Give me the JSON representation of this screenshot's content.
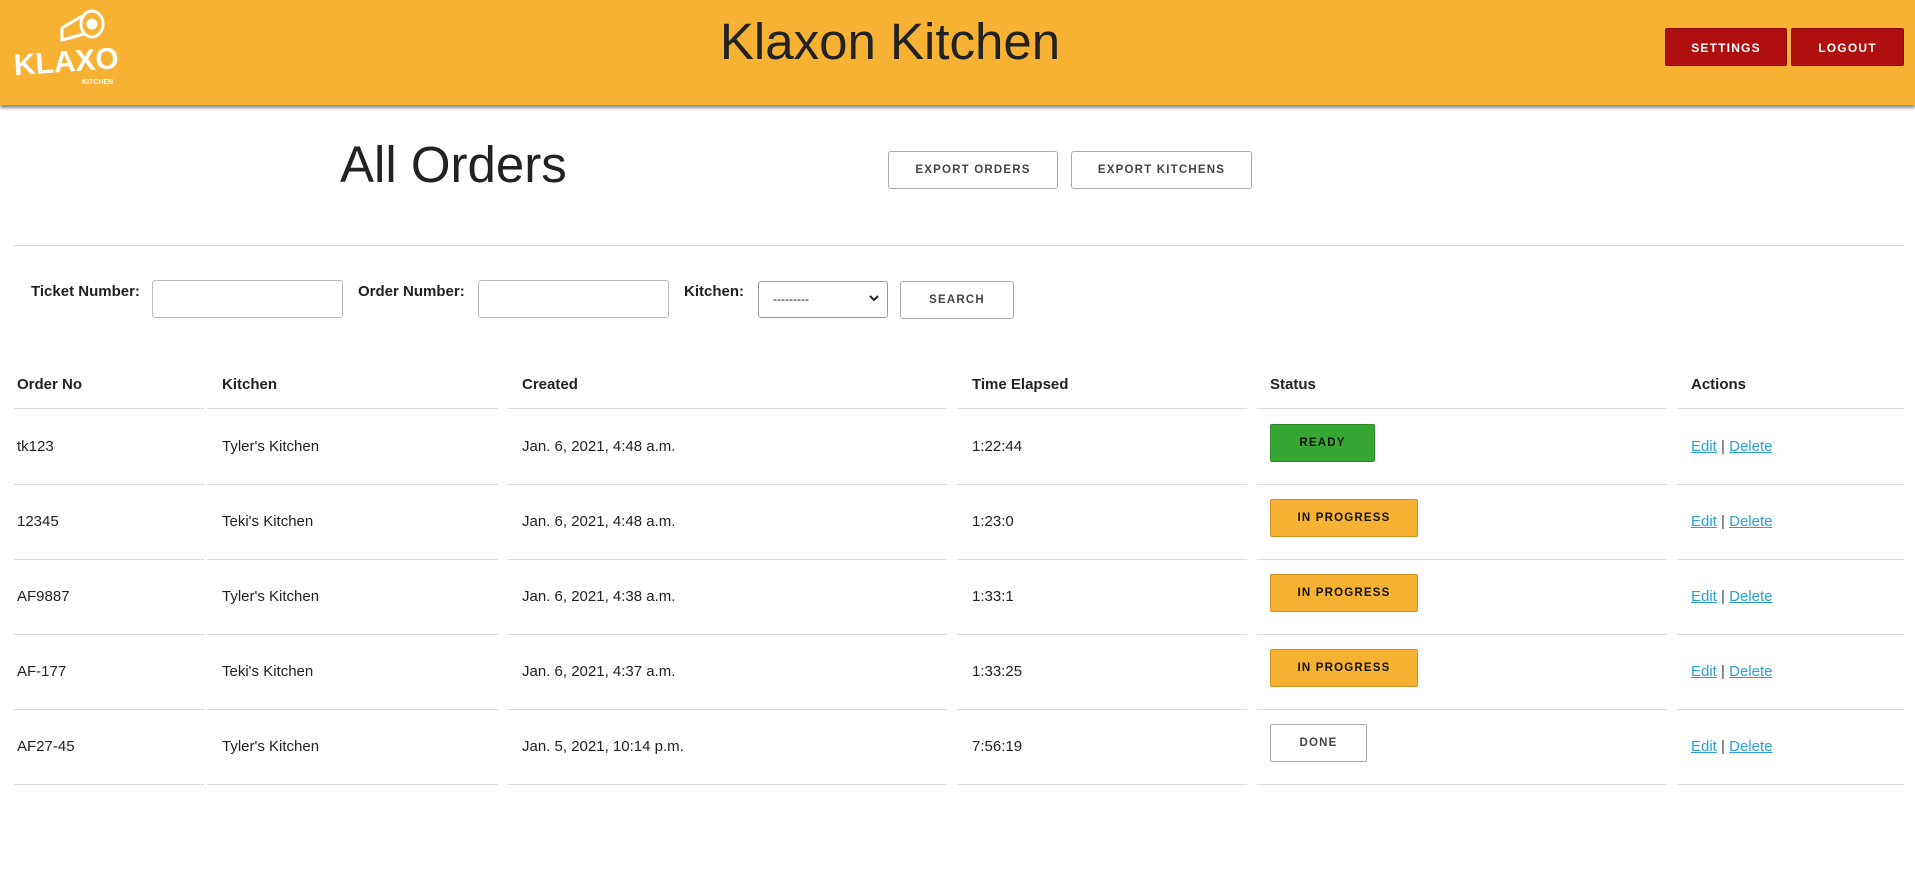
{
  "header": {
    "logo_text": "KLAXON",
    "logo_subtext": "KITCHEN",
    "title": "Klaxon Kitchen",
    "settings_label": "SETTINGS",
    "logout_label": "LOGOUT",
    "bg_color": "#f7b233",
    "button_color": "#b00f10"
  },
  "page": {
    "title": "All Orders",
    "export_orders_label": "EXPORT ORDERS",
    "export_kitchens_label": "EXPORT KITCHENS"
  },
  "search": {
    "ticket_label": "Ticket Number:",
    "ticket_value": "",
    "order_label": "Order Number:",
    "order_value": "",
    "kitchen_label": "Kitchen:",
    "kitchen_selected": "---------",
    "search_label": "SEARCH"
  },
  "table": {
    "columns": [
      "Order No",
      "Kitchen",
      "Created",
      "Time Elapsed",
      "Status",
      "Actions"
    ],
    "rows": [
      {
        "order_no": "tk123",
        "kitchen": "Tyler's Kitchen",
        "created": "Jan. 6, 2021, 4:48 a.m.",
        "elapsed": "1:22:44",
        "status": "READY",
        "edit": "Edit",
        "sep": "|",
        "delete": "Delete"
      },
      {
        "order_no": "12345",
        "kitchen": "Teki's Kitchen",
        "created": "Jan. 6, 2021, 4:48 a.m.",
        "elapsed": "1:23:0",
        "status": "IN PROGRESS",
        "edit": "Edit",
        "sep": "|",
        "delete": "Delete"
      },
      {
        "order_no": "AF9887",
        "kitchen": "Tyler's Kitchen",
        "created": "Jan. 6, 2021, 4:38 a.m.",
        "elapsed": "1:33:1",
        "status": "IN PROGRESS",
        "edit": "Edit",
        "sep": "|",
        "delete": "Delete"
      },
      {
        "order_no": "AF-177",
        "kitchen": "Teki's Kitchen",
        "created": "Jan. 6, 2021, 4:37 a.m.",
        "elapsed": "1:33:25",
        "status": "IN PROGRESS",
        "edit": "Edit",
        "sep": "|",
        "delete": "Delete"
      },
      {
        "order_no": "AF27-45",
        "kitchen": "Tyler's Kitchen",
        "created": "Jan. 5, 2021, 10:14 p.m.",
        "elapsed": "7:56:19",
        "status": "DONE",
        "edit": "Edit",
        "sep": "|",
        "delete": "Delete"
      }
    ]
  },
  "status_colors": {
    "ready": "#36a635",
    "in_progress": "#f7b233",
    "done": "#ffffff"
  },
  "link_color": "#2aa0d6"
}
